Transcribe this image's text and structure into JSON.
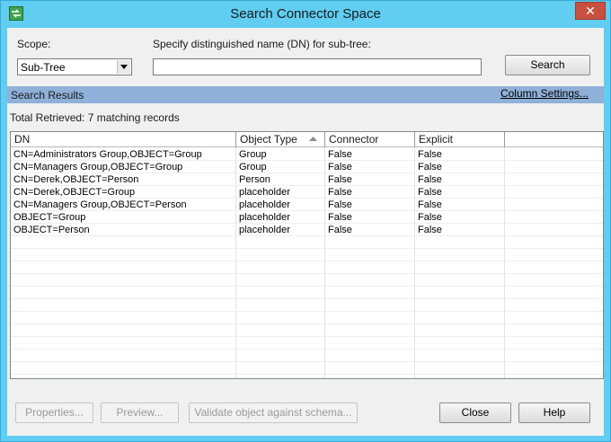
{
  "window": {
    "title": "Search Connector Space",
    "close_glyph": "✕",
    "icon": "app-icon",
    "title_color": "#60cdf1",
    "close_color": "#c7503f"
  },
  "filter": {
    "scope_label": "Scope:",
    "scope_value": "Sub-Tree",
    "dn_label": "Specify distinguished name (DN) for sub-tree:",
    "dn_value": "",
    "search_button": "Search"
  },
  "results": {
    "header": "Search Results",
    "column_settings": "Column Settings...",
    "total": "Total Retrieved: 7 matching records",
    "header_color": "#8fb0d8",
    "columns": [
      "DN",
      "Object Type",
      "Connector",
      "Explicit",
      ""
    ],
    "sorted_column": "Object Type",
    "rows": [
      [
        "CN=Administrators Group,OBJECT=Group",
        "Group",
        "False",
        "False"
      ],
      [
        "CN=Managers Group,OBJECT=Group",
        "Group",
        "False",
        "False"
      ],
      [
        "CN=Derek,OBJECT=Person",
        "Person",
        "False",
        "False"
      ],
      [
        "CN=Derek,OBJECT=Group",
        "placeholder",
        "False",
        "False"
      ],
      [
        "CN=Managers Group,OBJECT=Person",
        "placeholder",
        "False",
        "False"
      ],
      [
        "OBJECT=Group",
        "placeholder",
        "False",
        "False"
      ],
      [
        "OBJECT=Person",
        "placeholder",
        "False",
        "False"
      ]
    ]
  },
  "footer": {
    "properties": "Properties...",
    "preview": "Preview...",
    "validate": "Validate object against schema...",
    "close": "Close",
    "help": "Help"
  }
}
